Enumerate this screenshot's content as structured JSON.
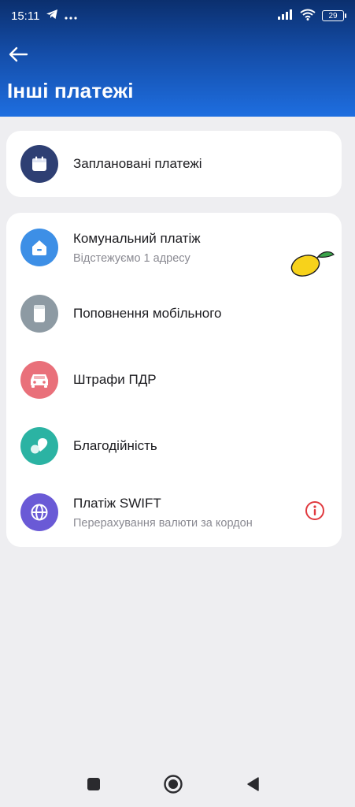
{
  "status_bar": {
    "time": "15:11",
    "battery": "29",
    "icons": [
      "telegram-icon",
      "more-dots-icon",
      "signal-icon",
      "wifi-icon",
      "battery-icon"
    ]
  },
  "header": {
    "title": "Інші платежі",
    "back_icon": "arrow-left-icon"
  },
  "scheduled": {
    "title": "Заплановані платежі",
    "icon": "calendar-icon",
    "color": "#2e3f73"
  },
  "items": [
    {
      "title": "Комунальний платіж",
      "subtitle": "Відстежуємо 1 адресу",
      "icon": "house-icon",
      "color": "#3d8fe6"
    },
    {
      "title": "Поповнення мобільного",
      "subtitle": "",
      "icon": "phone-icon",
      "color": "#8d9aa3"
    },
    {
      "title": "Штрафи ПДР",
      "subtitle": "",
      "icon": "car-icon",
      "color": "#e9707a"
    },
    {
      "title": "Благодійність",
      "subtitle": "",
      "icon": "hearts-icon",
      "color": "#2bb3a3"
    },
    {
      "title": "Платіж SWIFT",
      "subtitle": "Перерахування валюти за кордон",
      "icon": "globe-icon",
      "color": "#6a5ad6"
    }
  ],
  "info_icon": {
    "name": "info-icon",
    "color": "#e0393e"
  },
  "nav_bar": {
    "icons": [
      "square-icon",
      "home-circle-icon",
      "back-triangle-icon"
    ]
  }
}
